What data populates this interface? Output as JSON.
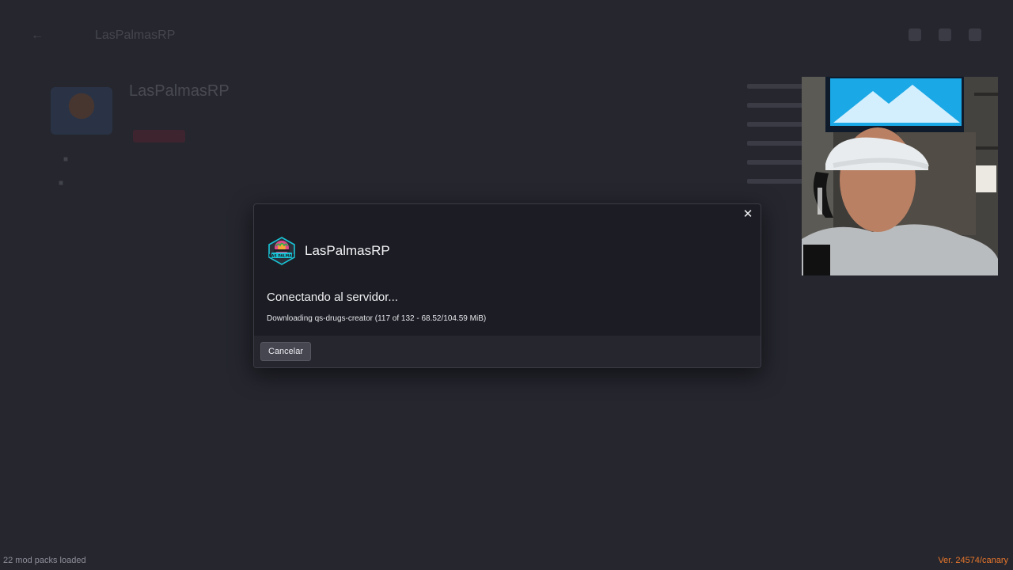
{
  "background": {
    "topbar_title": "LasPalmasRP",
    "server_name": "LasPalmasRP"
  },
  "modal": {
    "close_icon": "close-icon",
    "server_name": "LasPalmasRP",
    "logo_text": "LAS PALMAS",
    "status": "Conectando al servidor...",
    "detail": "Downloading qs-drugs-creator (117 of 132 - 68.52/104.59 MiB)",
    "download_progress": {
      "current": 117,
      "total": 132,
      "downloaded_mib": 68.52,
      "size_mib": 104.59
    },
    "cancel_label": "Cancelar"
  },
  "statusbar": {
    "mod_packs": "22 mod packs loaded",
    "version": "Ver. 24574/canary"
  },
  "colors": {
    "background": "#25262e",
    "modal_bg": "#1c1d24",
    "version_accent": "#e8772b"
  }
}
